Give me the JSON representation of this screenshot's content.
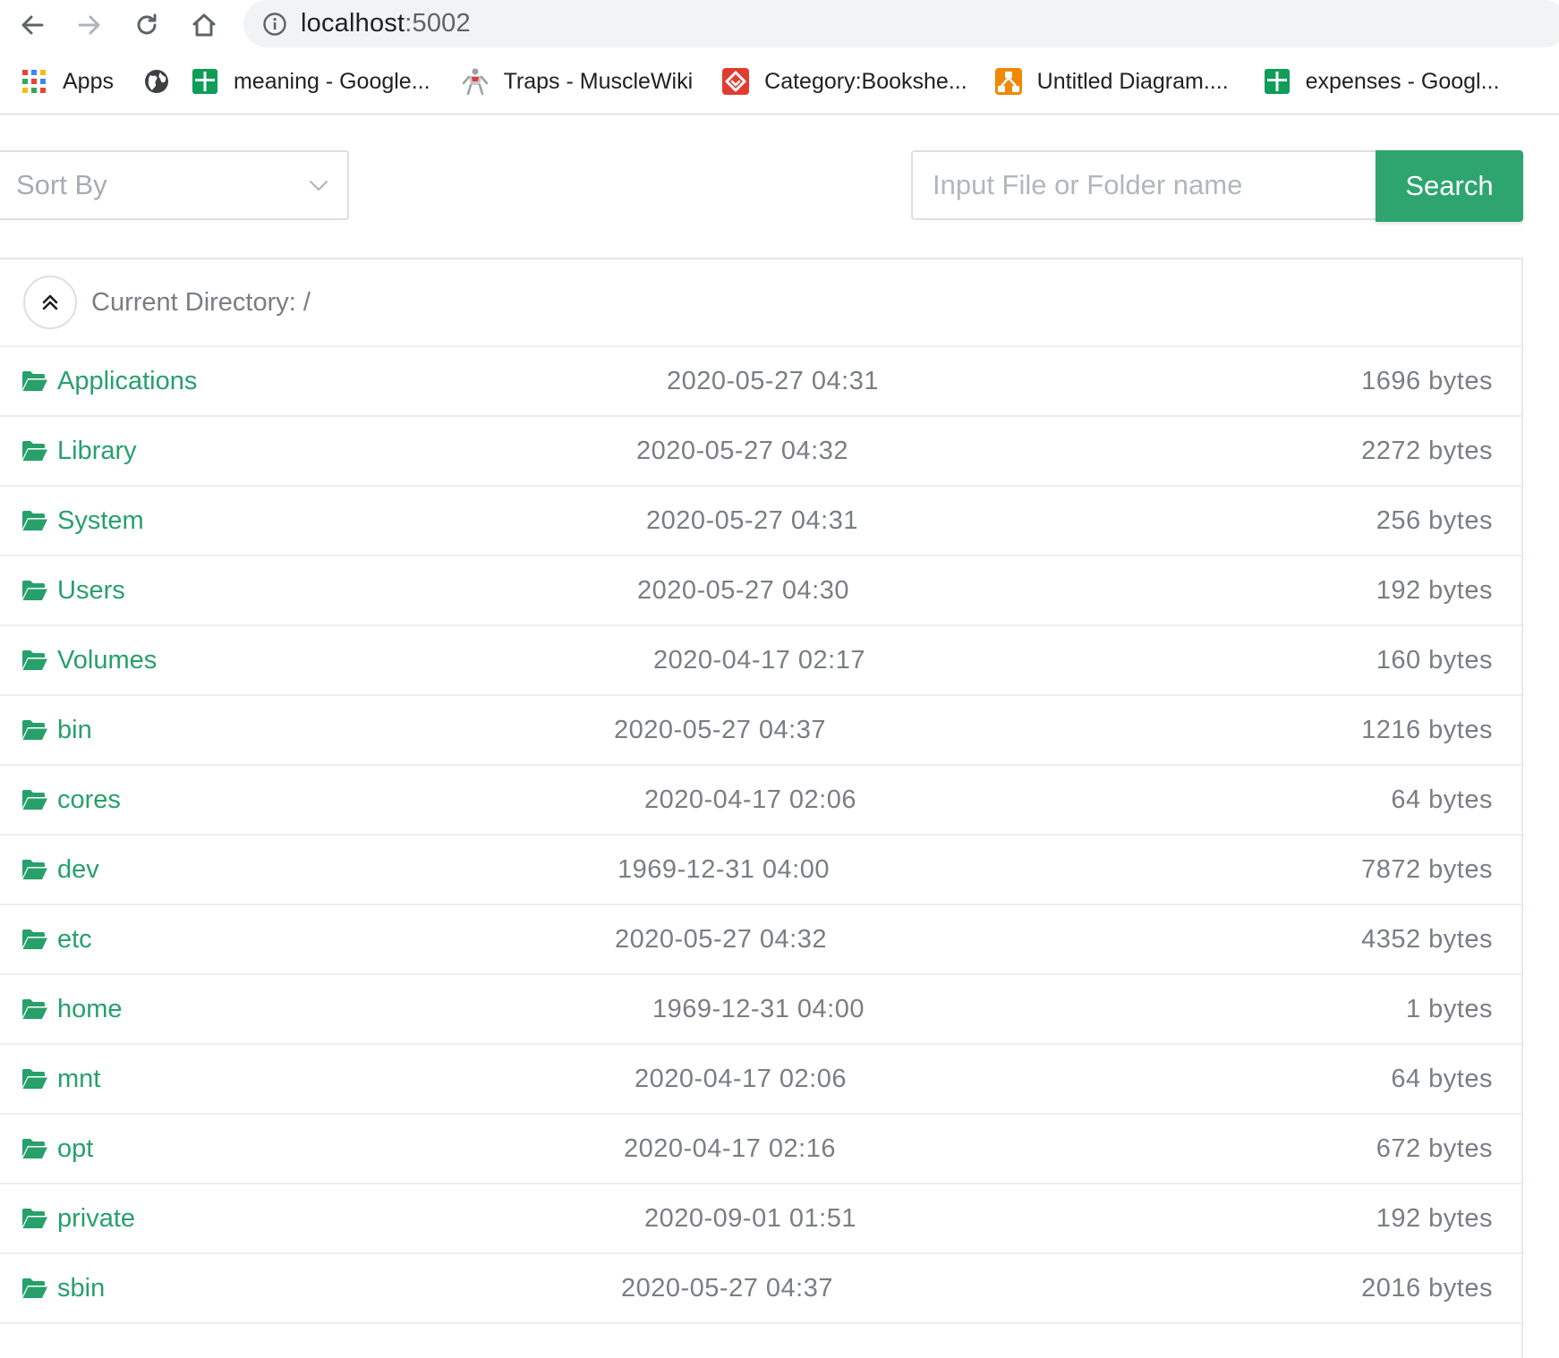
{
  "browser": {
    "url_host": "localhost",
    "url_port": ":5002"
  },
  "bookmarks": [
    {
      "label": "Apps",
      "icon": "apps-grid-icon"
    },
    {
      "label": "",
      "icon": "globe-icon"
    },
    {
      "label": "meaning - Google...",
      "icon": "google-sheets-icon"
    },
    {
      "label": "Traps - MuscleWiki",
      "icon": "musclewiki-icon"
    },
    {
      "label": "Category:Bookshe...",
      "icon": "gitbook-icon"
    },
    {
      "label": "Untitled Diagram....",
      "icon": "drawio-icon"
    },
    {
      "label": "expenses - Googl...",
      "icon": "google-sheets-icon"
    }
  ],
  "controls": {
    "sort_placeholder": "Sort By",
    "search_placeholder": "Input File or Folder name",
    "search_label": "Search"
  },
  "directory": {
    "label": "Current Directory: /"
  },
  "colors": {
    "accent": "#2ea56f",
    "link": "#27a06b",
    "muted_text": "#7a7d84"
  },
  "files": [
    {
      "name": "Applications",
      "date": "2020-05-27 04:31",
      "size": "1696 bytes"
    },
    {
      "name": "Library",
      "date": "2020-05-27 04:32",
      "size": "2272 bytes"
    },
    {
      "name": "System",
      "date": "2020-05-27 04:31",
      "size": "256 bytes"
    },
    {
      "name": "Users",
      "date": "2020-05-27 04:30",
      "size": "192 bytes"
    },
    {
      "name": "Volumes",
      "date": "2020-04-17 02:17",
      "size": "160 bytes"
    },
    {
      "name": "bin",
      "date": "2020-05-27 04:37",
      "size": "1216 bytes"
    },
    {
      "name": "cores",
      "date": "2020-04-17 02:06",
      "size": "64 bytes"
    },
    {
      "name": "dev",
      "date": "1969-12-31 04:00",
      "size": "7872 bytes"
    },
    {
      "name": "etc",
      "date": "2020-05-27 04:32",
      "size": "4352 bytes"
    },
    {
      "name": "home",
      "date": "1969-12-31 04:00",
      "size": "1 bytes"
    },
    {
      "name": "mnt",
      "date": "2020-04-17 02:06",
      "size": "64 bytes"
    },
    {
      "name": "opt",
      "date": "2020-04-17 02:16",
      "size": "672 bytes"
    },
    {
      "name": "private",
      "date": "2020-09-01 01:51",
      "size": "192 bytes"
    },
    {
      "name": "sbin",
      "date": "2020-05-27 04:37",
      "size": "2016 bytes"
    }
  ]
}
